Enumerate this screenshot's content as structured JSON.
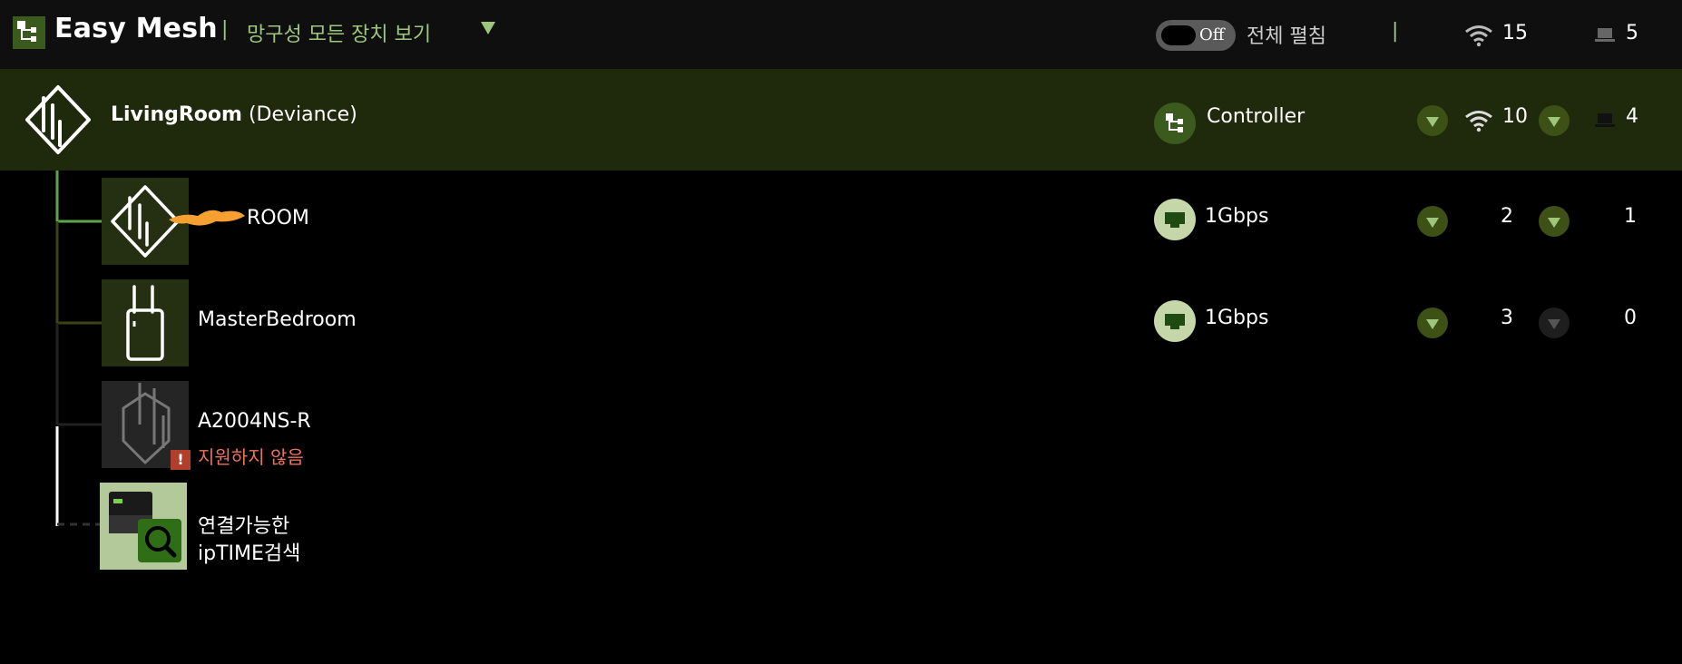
{
  "header": {
    "app_title": "Easy Mesh",
    "separator": "|",
    "filter_label": "망구성 모든 장치 보기",
    "toggle_state": "Off",
    "expand_all_label": "전체 펼침",
    "separator2": "|",
    "wifi_count": "15",
    "wired_count": "5"
  },
  "controller": {
    "name": "LivingRoom",
    "model": "(Deviance)",
    "role": "Controller",
    "wifi_count": "10",
    "wired_count": "4"
  },
  "nodes": [
    {
      "name": "ROOM",
      "link": "1Gbps",
      "wifi_count": "2",
      "wired_count": "1"
    },
    {
      "name": "MasterBedroom",
      "link": "1Gbps",
      "wifi_count": "3",
      "wired_count": "0"
    },
    {
      "name": "A2004NS-R",
      "status": "지원하지 않음",
      "status_icon": "!"
    }
  ],
  "search": {
    "label_line1": "연결가능한",
    "label_line2": "ipTIME검색"
  },
  "colors": {
    "accent_green": "#9dc77d",
    "controller_row_bg": "#1f2a0c",
    "warning": "#e9735f",
    "redaction": "#f5a030"
  }
}
